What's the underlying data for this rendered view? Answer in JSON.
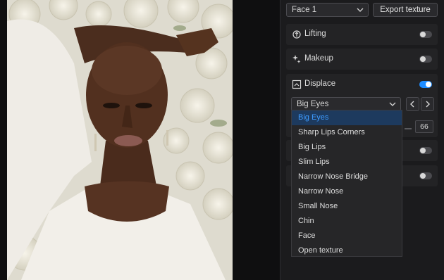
{
  "face_select": {
    "value": "Face 1"
  },
  "export_button": {
    "label": "Export texture"
  },
  "features": [
    {
      "name": "Lifting",
      "icon": "lifting-icon",
      "enabled": false
    },
    {
      "name": "Makeup",
      "icon": "makeup-icon",
      "enabled": false
    },
    {
      "name": "Displace",
      "icon": "displace-icon",
      "enabled": true
    }
  ],
  "displace": {
    "preset": "Big Eyes",
    "amount": "66"
  },
  "extra_toggles": [
    {
      "enabled": false
    },
    {
      "enabled": false
    }
  ],
  "preset_menu": {
    "items": [
      "Big Eyes",
      "Sharp Lips Corners",
      "Big Lips",
      "Slim Lips",
      "Narrow Nose Bridge",
      "Narrow Nose",
      "Small Nose",
      "Chin",
      "Face",
      "Open texture"
    ],
    "selected": "Big Eyes"
  },
  "colors": {
    "accent": "#1e8cff",
    "selected_bg": "#1d3a5e",
    "selected_text": "#3d9bff"
  }
}
